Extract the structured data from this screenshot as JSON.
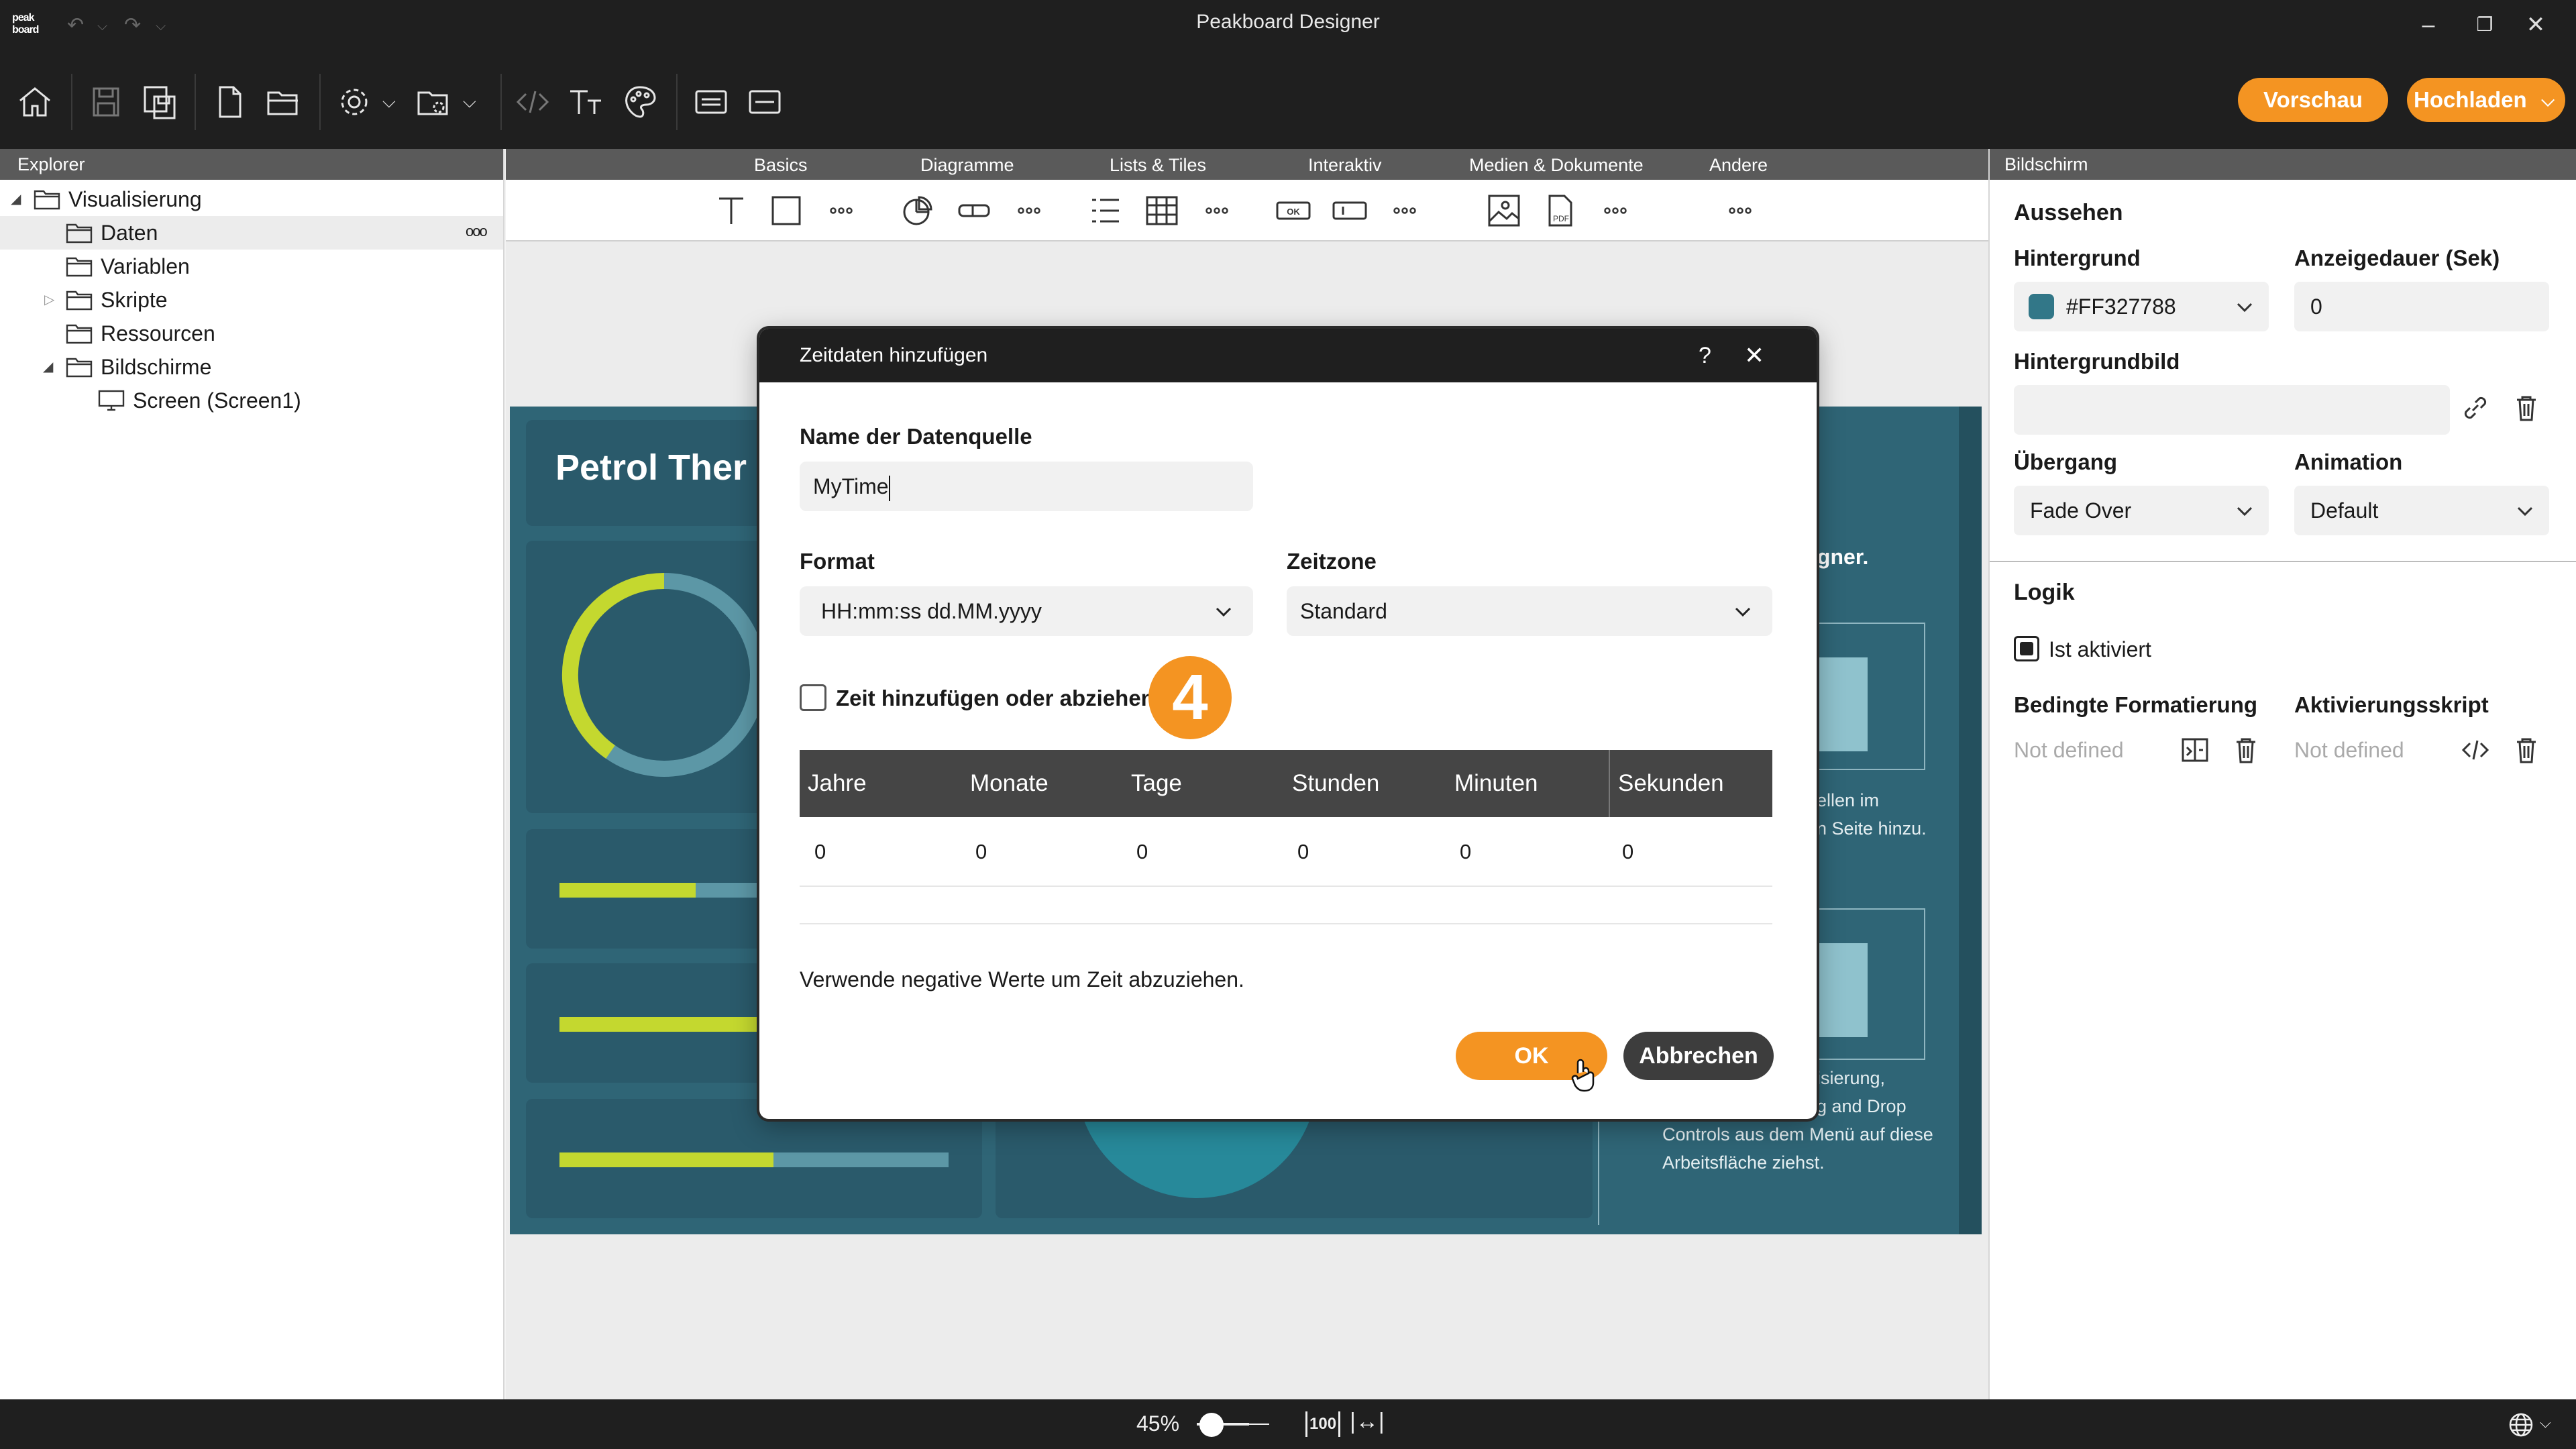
{
  "window": {
    "title": "Peakboard Designer",
    "logo_line1": "peak",
    "logo_line2": "board"
  },
  "toolbar": {
    "preview_label": "Vorschau",
    "upload_label": "Hochladen"
  },
  "explorer": {
    "header": "Explorer",
    "items": [
      {
        "label": "Visualisierung"
      },
      {
        "label": "Daten"
      },
      {
        "label": "Variablen"
      },
      {
        "label": "Skripte"
      },
      {
        "label": "Ressourcen"
      },
      {
        "label": "Bildschirme"
      },
      {
        "label": "Screen (Screen1)"
      }
    ]
  },
  "categories": [
    "Basics",
    "Diagramme",
    "Lists & Tiles",
    "Interaktiv",
    "Medien & Dokumente",
    "Andere"
  ],
  "canvas": {
    "title": "Petrol Ther",
    "designer_suffix": "igner.",
    "hint1_line1": "ellen im",
    "hint1_line2": "n Seite hinzu.",
    "hint2_line1": "isierung,",
    "hint2_line2": "g and Drop",
    "hint2_line3": "Controls aus dem Menü auf diese",
    "hint2_line4": "Arbeitsfläche ziehst.",
    "bars": [
      0.35,
      0.6,
      0.55
    ]
  },
  "dialog": {
    "title": "Zeitdaten hinzufügen",
    "help": "?",
    "name_label": "Name der Datenquelle",
    "name_value": "MyTime",
    "format_label": "Format",
    "format_value": "HH:mm:ss dd.MM.yyyy",
    "timezone_label": "Zeitzone",
    "timezone_value": "Standard",
    "checkbox_label": "Zeit hinzufügen oder abziehen",
    "step_badge": "4",
    "columns": [
      "Jahre",
      "Monate",
      "Tage",
      "Stunden",
      "Minuten",
      "Sekunden"
    ],
    "values": [
      "0",
      "0",
      "0",
      "0",
      "0",
      "0"
    ],
    "hint": "Verwende negative Werte um Zeit abzuziehen.",
    "ok_label": "OK",
    "cancel_label": "Abbrechen"
  },
  "properties": {
    "header": "Bildschirm",
    "section_look": "Aussehen",
    "background_label": "Hintergrund",
    "background_value": "#FF327788",
    "background_swatch": "#327788",
    "duration_label": "Anzeigedauer (Sek)",
    "duration_value": "0",
    "bgimage_label": "Hintergrundbild",
    "transition_label": "Übergang",
    "transition_value": "Fade Over",
    "animation_label": "Animation",
    "animation_value": "Default",
    "section_logic": "Logik",
    "active_label": "Ist aktiviert",
    "cond_format_label": "Bedingte Formatierung",
    "cond_format_value": "Not defined",
    "activation_script_label": "Aktivierungsskript",
    "activation_script_value": "Not defined"
  },
  "statusbar": {
    "zoom": "45%",
    "reset_label": "100"
  },
  "colors": {
    "accent": "#f49422",
    "dark": "#1f1f1f",
    "canvas": "#2f6576",
    "lime": "#c4d82f"
  }
}
